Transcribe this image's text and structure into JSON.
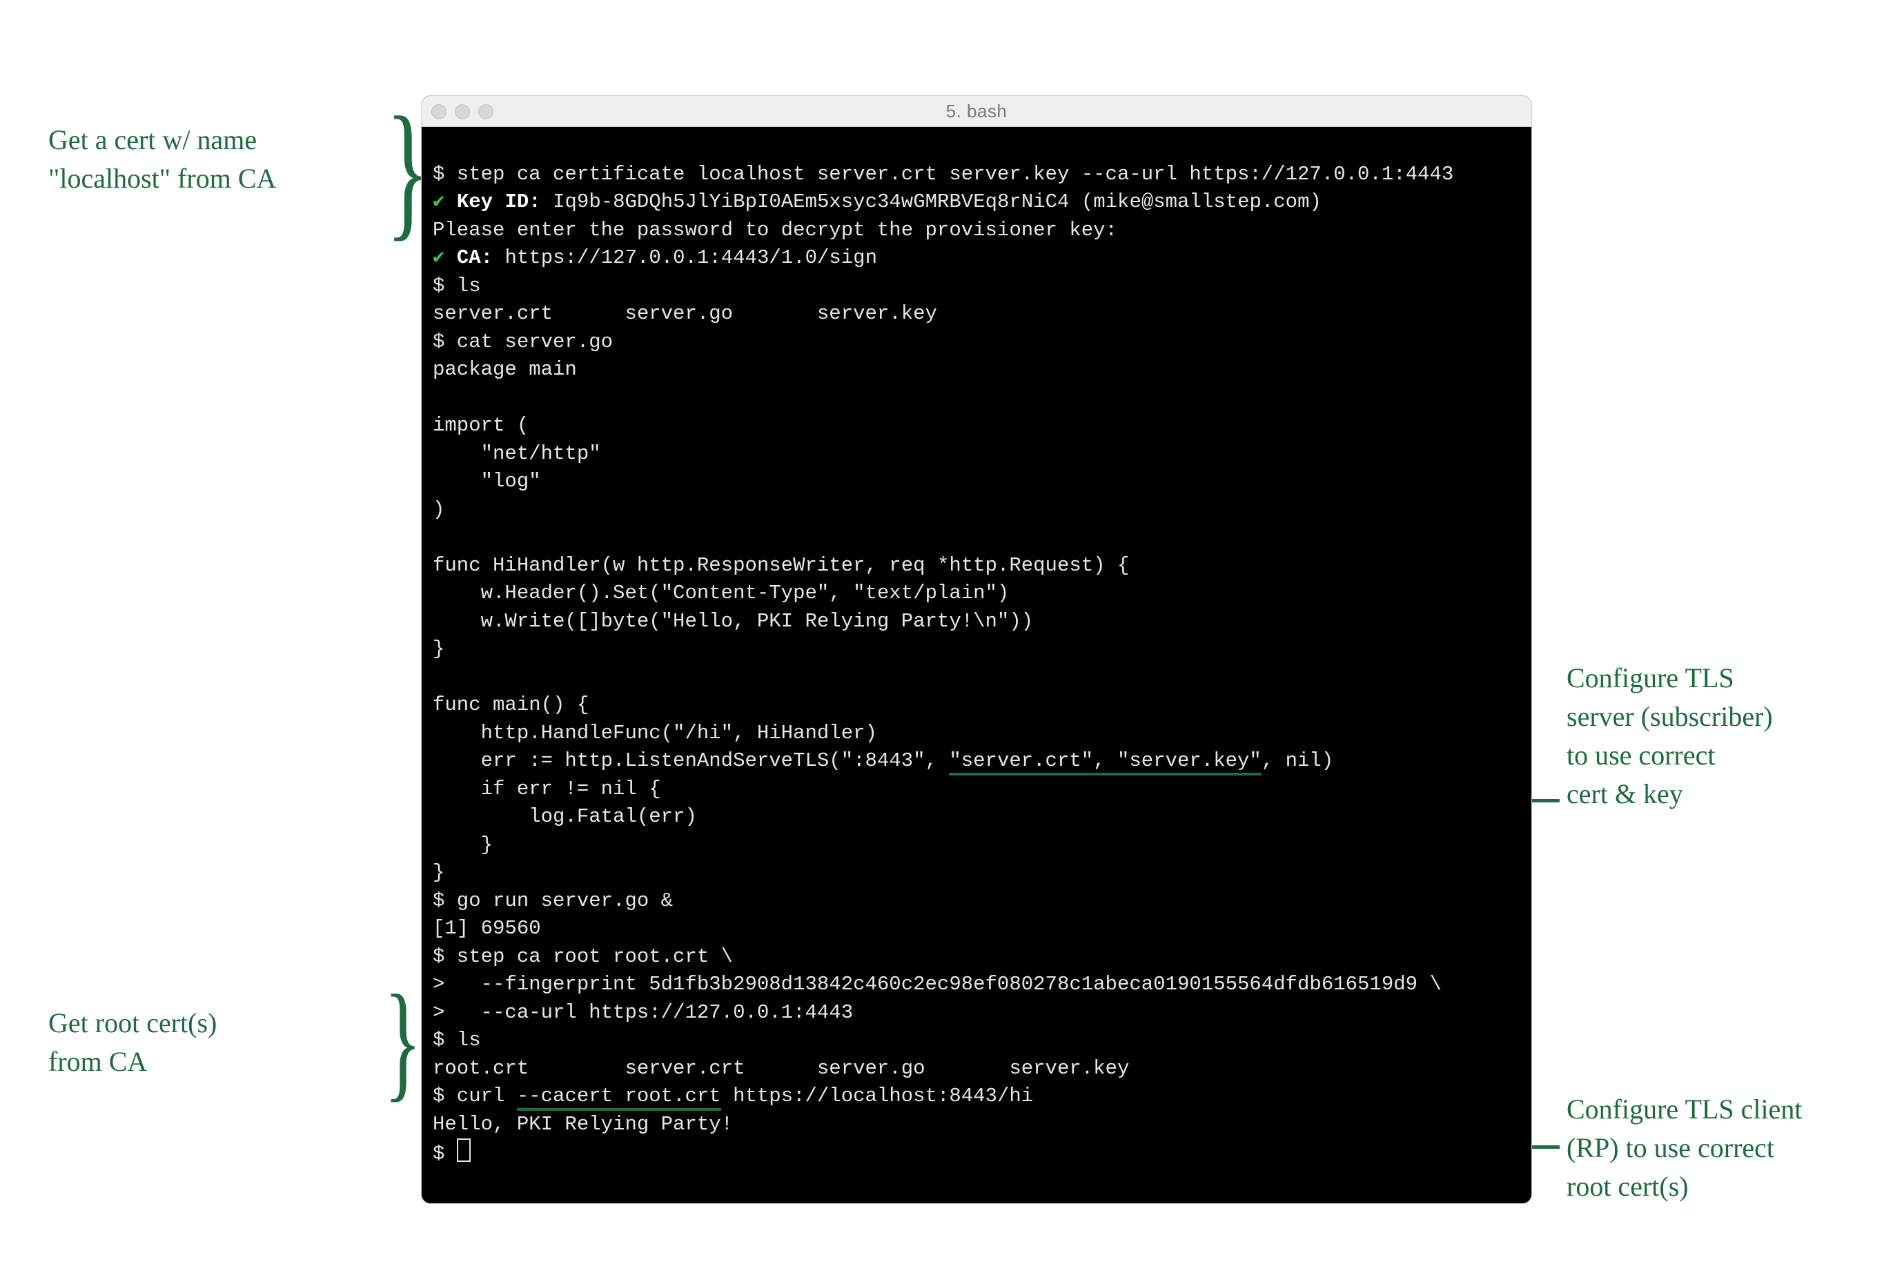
{
  "window": {
    "title": "5. bash"
  },
  "annotations": {
    "a1": "Get a cert w/ name\n\"localhost\" from CA",
    "a2": "Get root cert(s)\nfrom CA",
    "a3": "Configure TLS\nserver (subscriber)\nto use correct\ncert & key",
    "a4": "Configure TLS client\n(RP) to use correct\nroot cert(s)"
  },
  "terminal": {
    "prompt": "$",
    "cont": ">",
    "check": "✔",
    "cmd1": " step ca certificate localhost server.crt server.key --ca-url https://127.0.0.1:4443",
    "key_label": " Key ID:",
    "key_val": " Iq9b-8GDQh5JlYiBpI0AEm5xsyc34wGMRBVEq8rNiC4 (mike@smallstep.com)",
    "pw_prompt": "Please enter the password to decrypt the provisioner key:",
    "ca_label": " CA:",
    "ca_val": " https://127.0.0.1:4443/1.0/sign",
    "cmd_ls": " ls",
    "ls1": "server.crt      server.go       server.key",
    "cmd_cat": " cat server.go",
    "go01": "package main",
    "go02": "",
    "go03": "import (",
    "go04": "    \"net/http\"",
    "go05": "    \"log\"",
    "go06": ")",
    "go07": "",
    "go08": "func HiHandler(w http.ResponseWriter, req *http.Request) {",
    "go09": "    w.Header().Set(\"Content-Type\", \"text/plain\")",
    "go10": "    w.Write([]byte(\"Hello, PKI Relying Party!\\n\"))",
    "go11": "}",
    "go12": "",
    "go13": "func main() {",
    "go14": "    http.HandleFunc(\"/hi\", HiHandler)",
    "go15a": "    err := http.ListenAndServeTLS(\":8443\", ",
    "go15b": "\"server.crt\", \"server.key\"",
    "go15c": ", nil)",
    "go16": "    if err != nil {",
    "go17": "        log.Fatal(err)",
    "go18": "    }",
    "go19": "}",
    "cmd_run": " go run server.go &",
    "job": "[1] 69560",
    "cmd_root1": " step ca root root.crt \\",
    "cmd_root2": "   --fingerprint 5d1fb3b2908d13842c460c2ec98ef080278c1abeca0190155564dfdb616519d9 \\",
    "cmd_root3": "   --ca-url https://127.0.0.1:4443",
    "ls2": "root.crt        server.crt      server.go       server.key",
    "cmd_curl_a": " curl ",
    "cmd_curl_b": "--cacert root.crt",
    "cmd_curl_c": " https://localhost:8443/hi",
    "curl_out": "Hello, PKI Relying Party!",
    "final_prompt": " "
  }
}
